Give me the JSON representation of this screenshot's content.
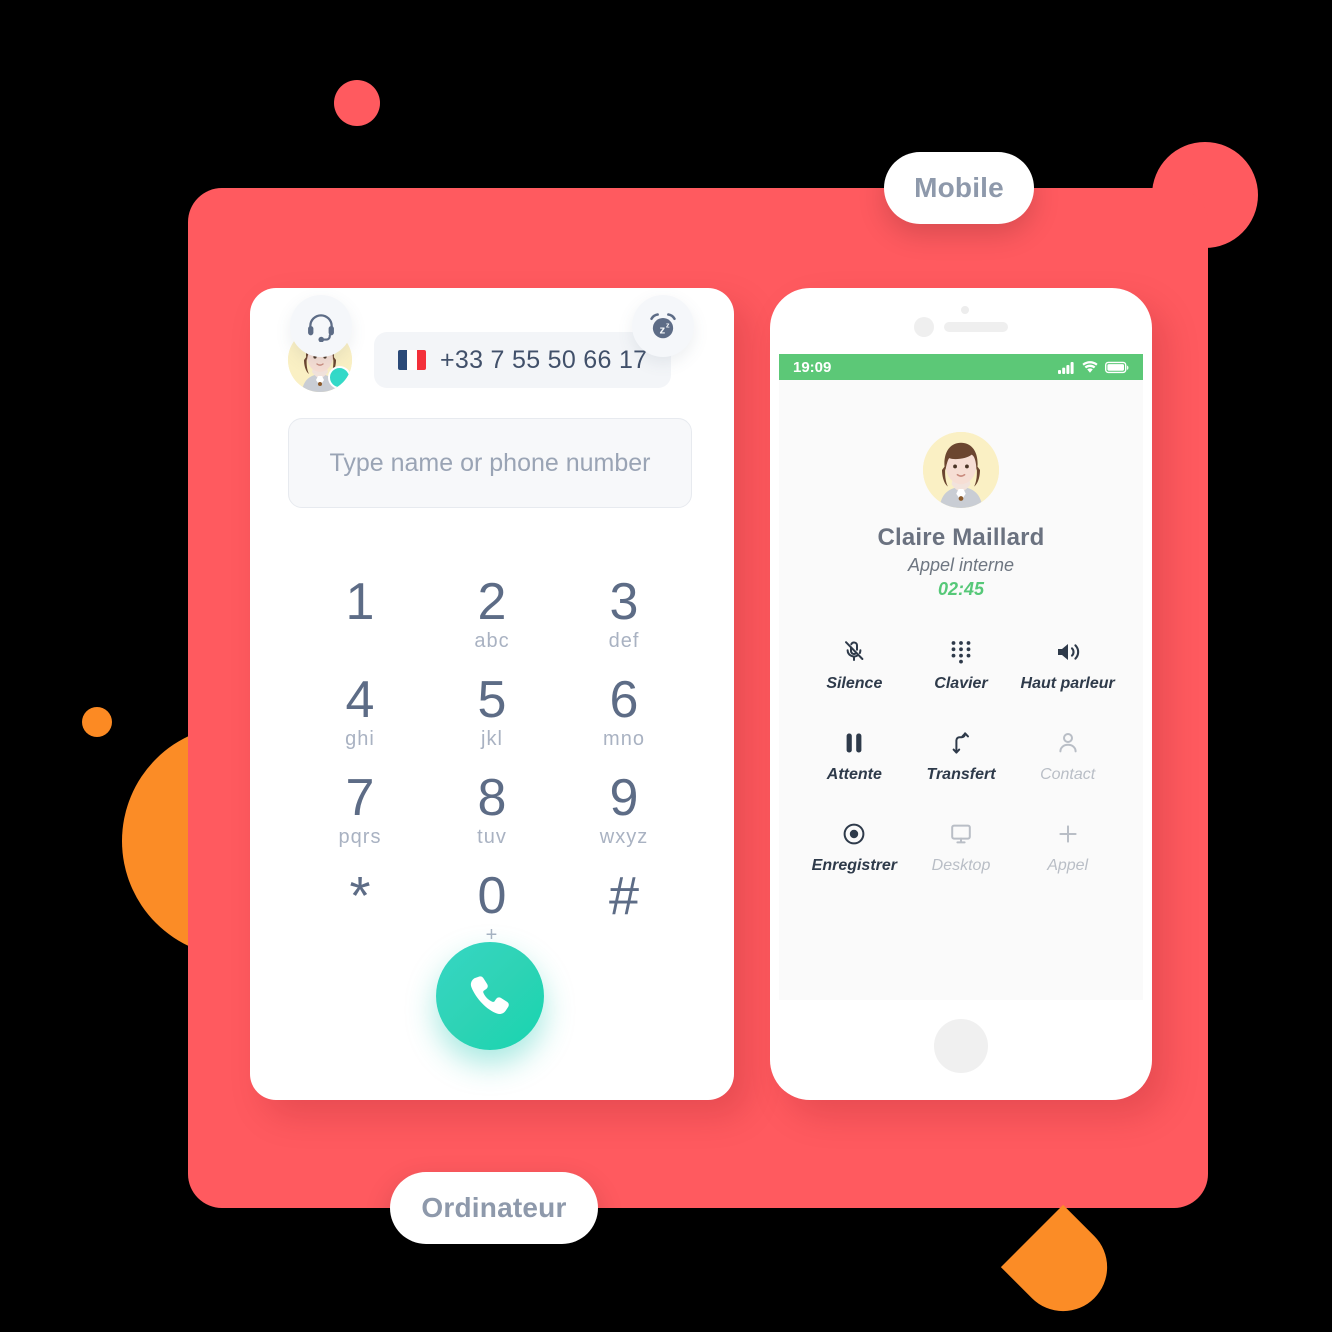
{
  "labels": {
    "mobile": "Mobile",
    "ordinateur": "Ordinateur"
  },
  "colors": {
    "panel_red": "#FF5A5F",
    "accent_orange": "#FB8C26",
    "call_green": "#2ED3B5",
    "status_bar_green": "#5CC877",
    "hangup_red": "#EE4B4B",
    "presence_teal": "#33D9C8",
    "text_slate": "#5D6C86"
  },
  "desktop": {
    "phone_number": "+33 7 55 50 66 17",
    "flag_icon": "flag-france-icon",
    "avatar_icon": "user-avatar",
    "presence_icon": "online-status-dot",
    "search": {
      "value": "",
      "placeholder": "Type name or phone number"
    },
    "dialpad": [
      {
        "digit": "1",
        "letters": ""
      },
      {
        "digit": "2",
        "letters": "abc"
      },
      {
        "digit": "3",
        "letters": "def"
      },
      {
        "digit": "4",
        "letters": "ghi"
      },
      {
        "digit": "5",
        "letters": "jkl"
      },
      {
        "digit": "6",
        "letters": "mno"
      },
      {
        "digit": "7",
        "letters": "pqrs"
      },
      {
        "digit": "8",
        "letters": "tuv"
      },
      {
        "digit": "9",
        "letters": "wxyz"
      },
      {
        "digit": "*",
        "letters": ""
      },
      {
        "digit": "0",
        "letters": "+"
      },
      {
        "digit": "#",
        "letters": ""
      }
    ],
    "actions": {
      "headset_icon": "headset-icon",
      "call_icon": "phone-icon",
      "snooze_icon": "alarm-snooze-icon"
    }
  },
  "mobile": {
    "status_bar": {
      "time": "19:09",
      "signal_icon": "cellular-signal-icon",
      "wifi_icon": "wifi-icon",
      "battery_icon": "battery-icon"
    },
    "caller": {
      "avatar_icon": "caller-avatar",
      "name": "Claire Maillard",
      "call_type": "Appel interne",
      "duration": "02:45"
    },
    "controls": [
      {
        "label": "Silence",
        "icon": "mic-off-icon",
        "dim": false
      },
      {
        "label": "Clavier",
        "icon": "dialpad-icon",
        "dim": false
      },
      {
        "label": "Haut parleur",
        "icon": "speaker-icon",
        "dim": false
      },
      {
        "label": "Attente",
        "icon": "pause-icon",
        "dim": false
      },
      {
        "label": "Transfert",
        "icon": "transfer-icon",
        "dim": false
      },
      {
        "label": "Contact",
        "icon": "person-icon",
        "dim": true
      },
      {
        "label": "Enregistrer",
        "icon": "record-icon",
        "dim": false
      },
      {
        "label": "Desktop",
        "icon": "monitor-icon",
        "dim": true
      },
      {
        "label": "Appel",
        "icon": "plus-icon",
        "dim": true
      }
    ],
    "hangup_icon": "hang-up-icon",
    "home_icon": "home-button"
  }
}
